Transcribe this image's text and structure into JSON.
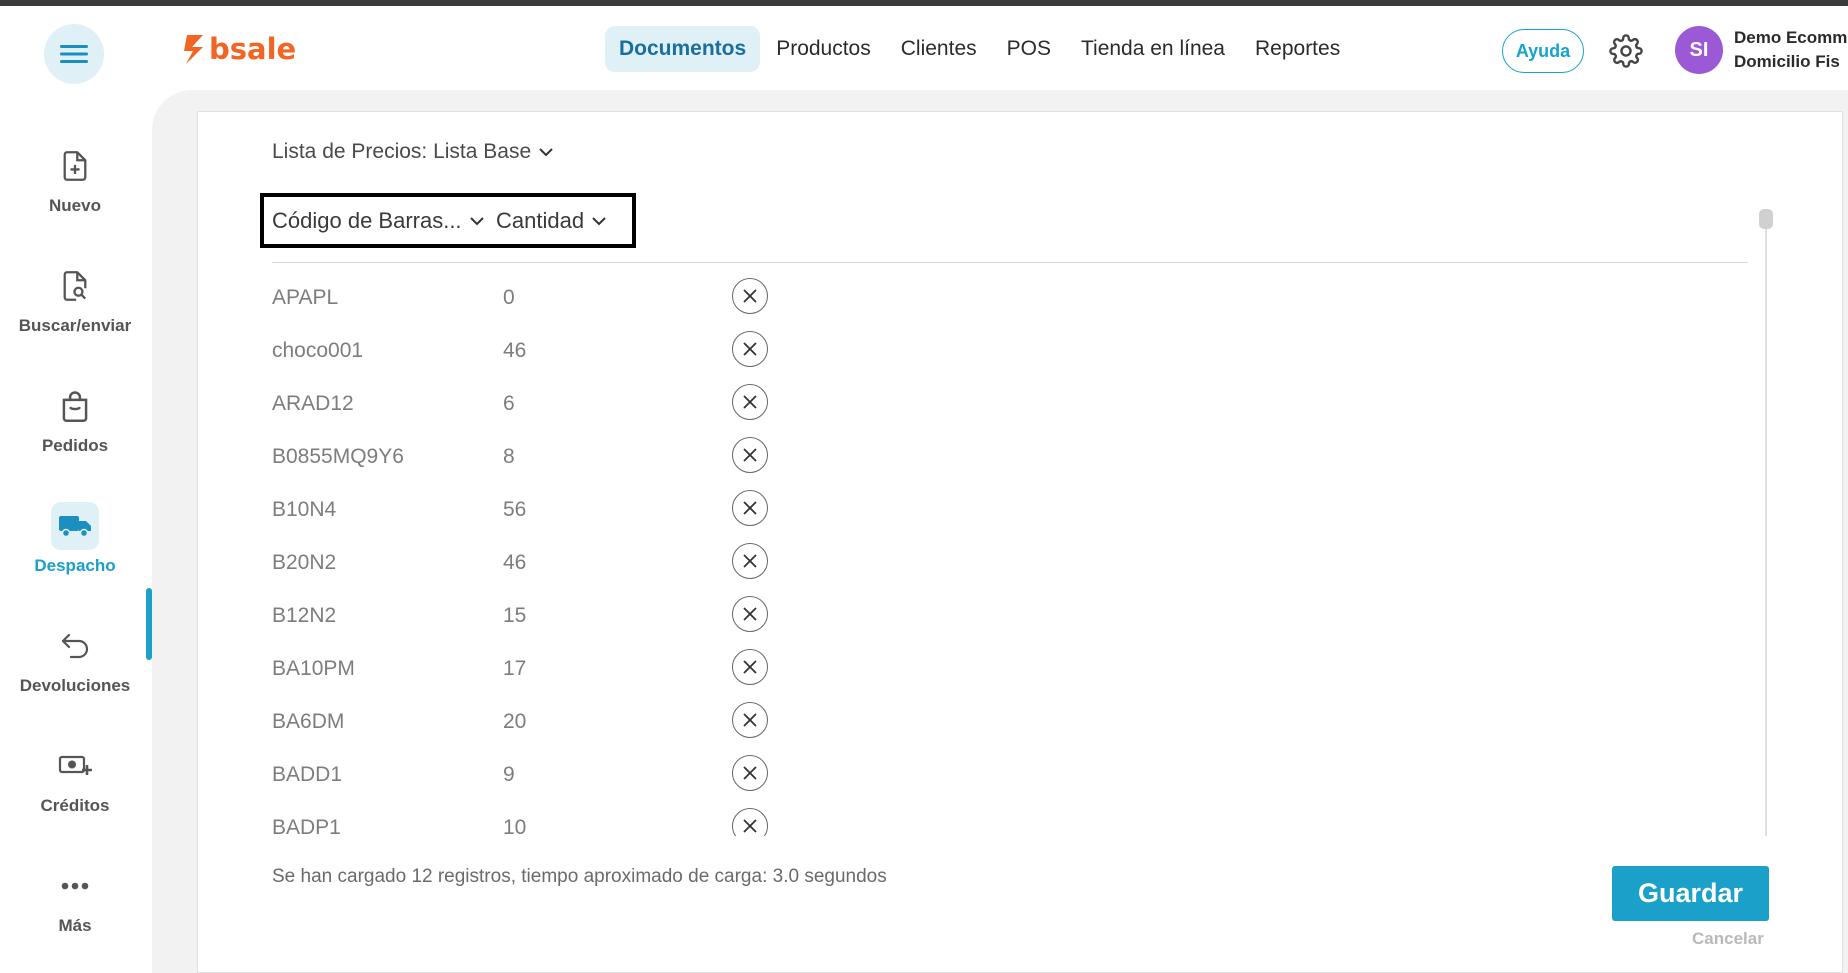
{
  "header": {
    "logo_text": "bsale",
    "nav": [
      {
        "label": "Documentos",
        "active": true
      },
      {
        "label": "Productos",
        "active": false
      },
      {
        "label": "Clientes",
        "active": false
      },
      {
        "label": "POS",
        "active": false
      },
      {
        "label": "Tienda en línea",
        "active": false
      },
      {
        "label": "Reportes",
        "active": false
      }
    ],
    "help_label": "Ayuda",
    "avatar_initials": "SI",
    "account_line1": "Demo Ecomm",
    "account_line2": "Domicilio Fis",
    "brand_color": "#f26522",
    "accent_color": "#1aa0c9"
  },
  "sidebar": {
    "items": [
      {
        "label": "Nuevo",
        "icon": "file-plus-icon",
        "active": false
      },
      {
        "label": "Buscar/enviar",
        "icon": "file-search-icon",
        "active": false
      },
      {
        "label": "Pedidos",
        "icon": "shopping-bag-icon",
        "active": false
      },
      {
        "label": "Despacho",
        "icon": "truck-icon",
        "active": true
      },
      {
        "label": "Devoluciones",
        "icon": "return-arrow-icon",
        "active": false
      },
      {
        "label": "Créditos",
        "icon": "money-plus-icon",
        "active": false
      },
      {
        "label": "Más",
        "icon": "more-dots-icon",
        "active": false
      }
    ]
  },
  "main": {
    "price_list_label": "Lista de Precios: Lista Base",
    "column_code_label": "Código de Barras...",
    "column_qty_label": "Cantidad",
    "rows": [
      {
        "code": "APAPL",
        "qty": "0"
      },
      {
        "code": "choco001",
        "qty": "46"
      },
      {
        "code": "ARAD12",
        "qty": "6"
      },
      {
        "code": "B0855MQ9Y6",
        "qty": "8"
      },
      {
        "code": "B10N4",
        "qty": "56"
      },
      {
        "code": "B20N2",
        "qty": "46"
      },
      {
        "code": "B12N2",
        "qty": "15"
      },
      {
        "code": "BA10PM",
        "qty": "17"
      },
      {
        "code": "BA6DM",
        "qty": "20"
      },
      {
        "code": "BADD1",
        "qty": "9"
      },
      {
        "code": "BADP1",
        "qty": "10"
      }
    ],
    "status_text": "Se han cargado 12 registros, tiempo aproximado de carga: 3.0 segundos",
    "save_label": "Guardar",
    "cancel_label": "Cancelar"
  }
}
